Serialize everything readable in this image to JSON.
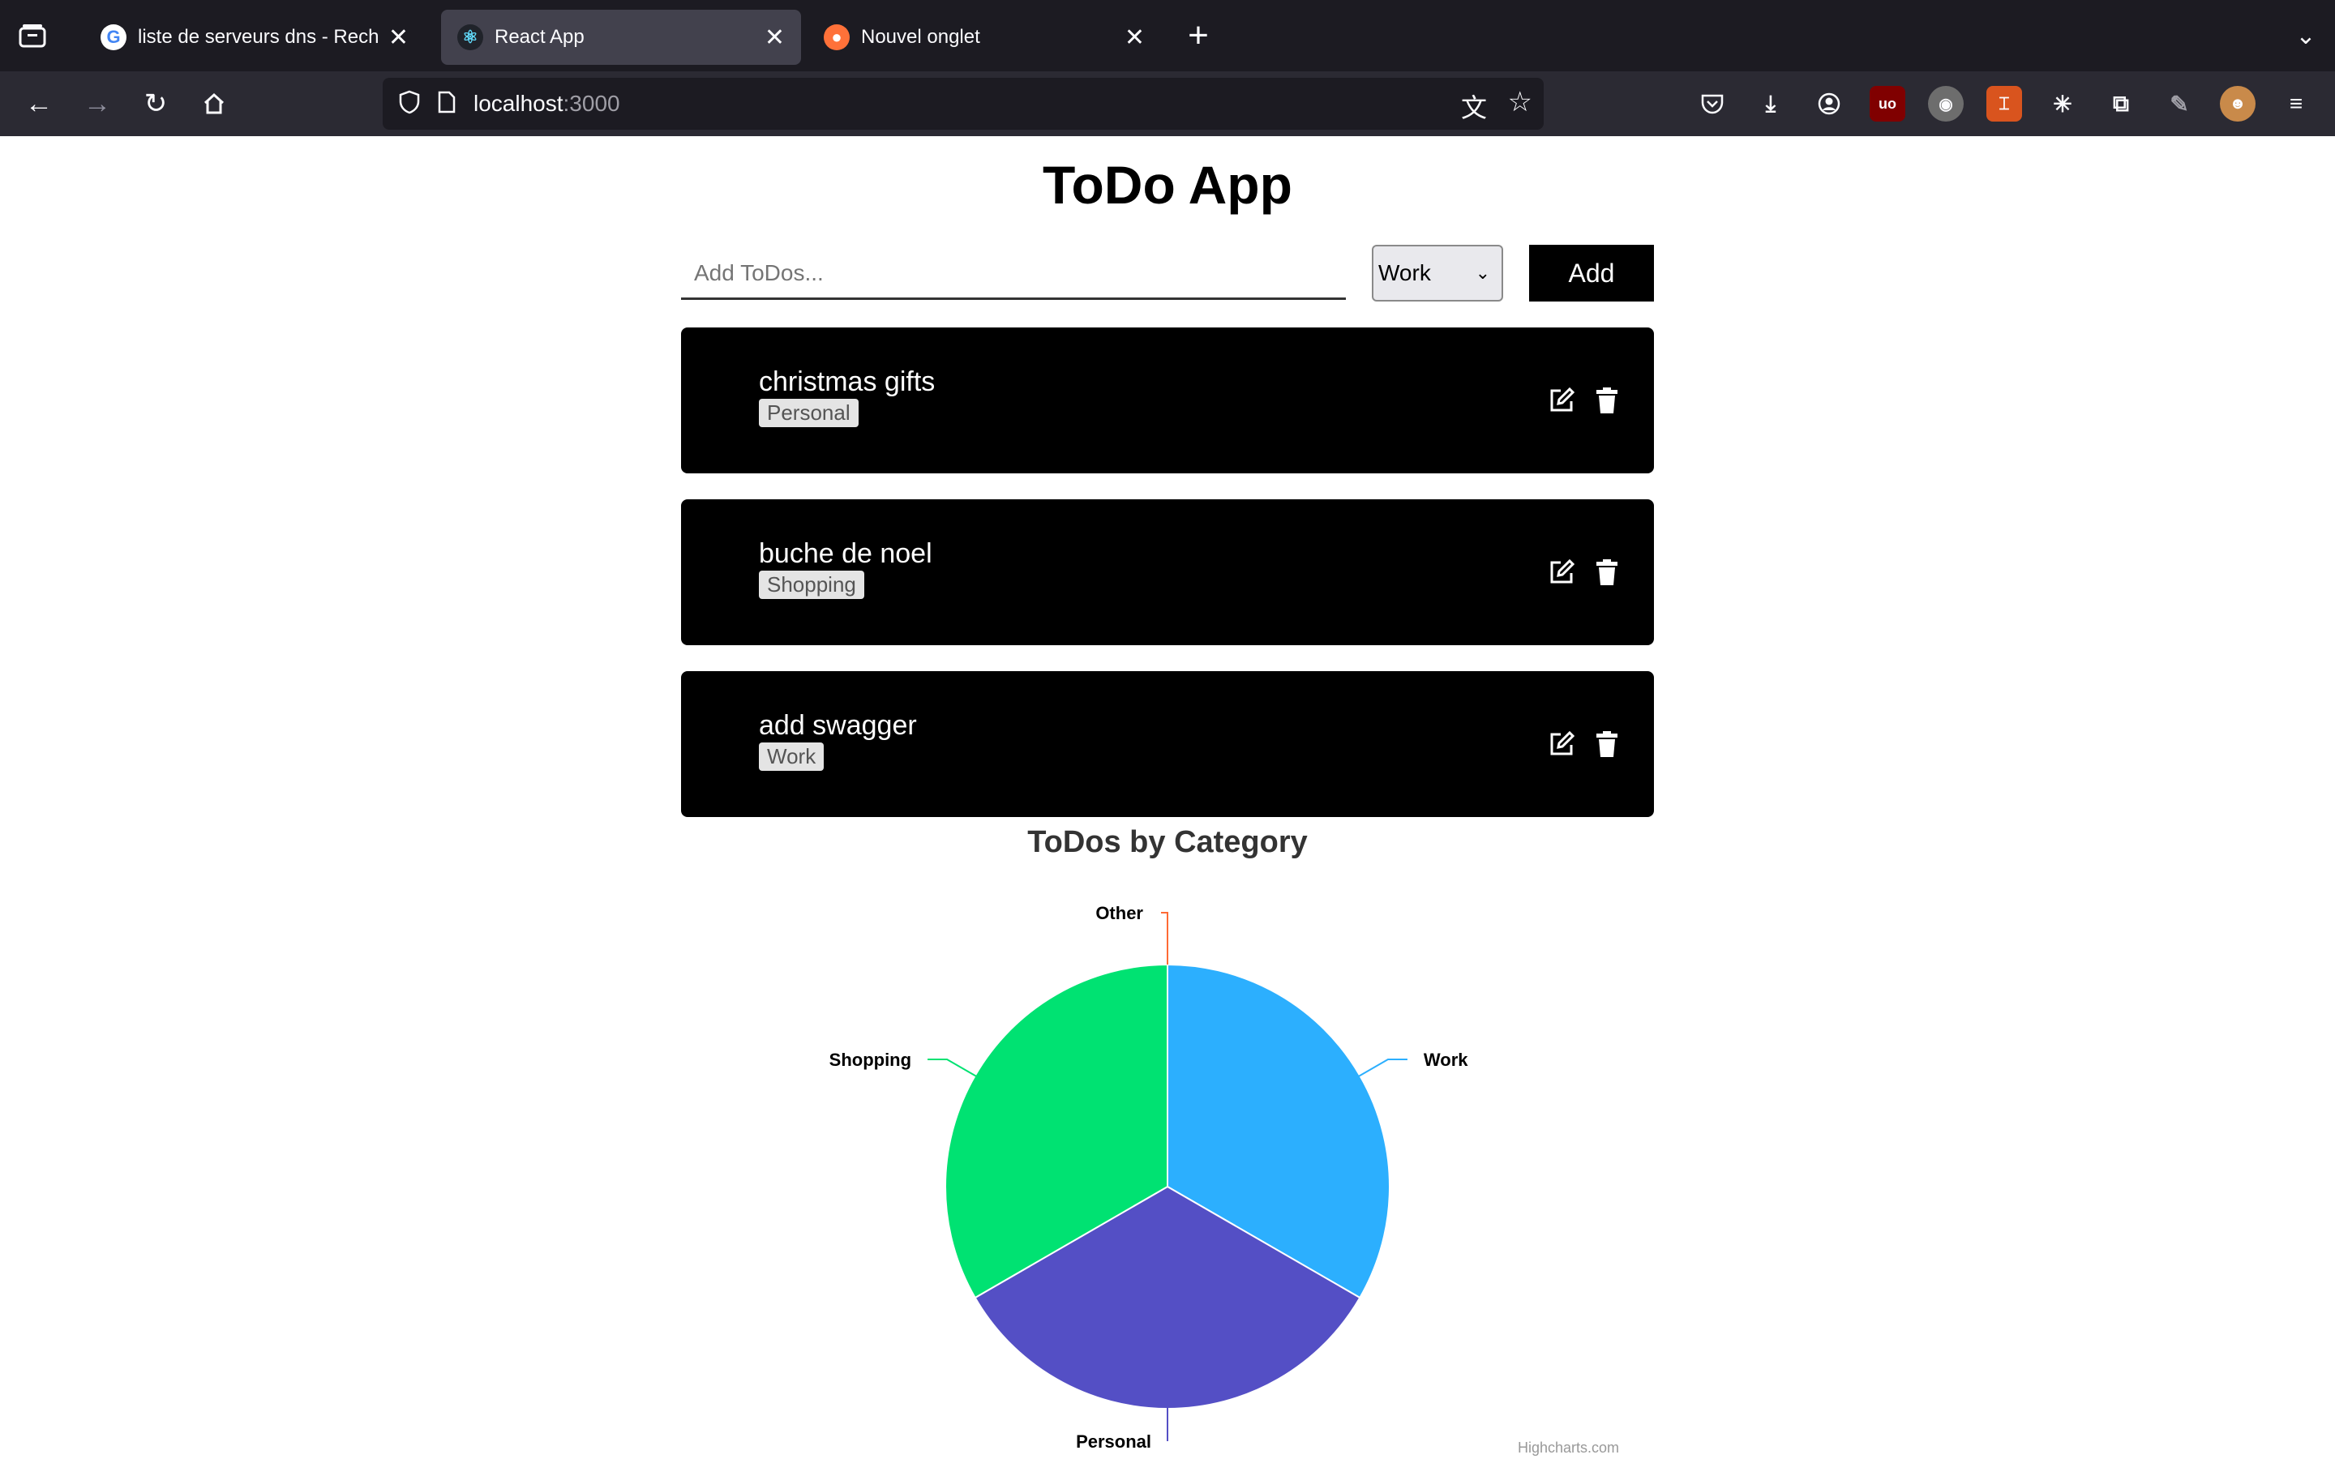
{
  "browser": {
    "tabs": [
      {
        "title": "liste de serveurs dns - Recherch",
        "favicon": "google-icon",
        "active": false
      },
      {
        "title": "React App",
        "favicon": "react-icon",
        "active": true
      },
      {
        "title": "Nouvel onglet",
        "favicon": "firefox-icon",
        "active": false
      }
    ],
    "new_tab_label": "+",
    "url": {
      "host": "localhost",
      "port": ":3000"
    }
  },
  "app": {
    "title": "ToDo App",
    "input": {
      "placeholder": "Add ToDos...",
      "value": ""
    },
    "category_select": {
      "selected": "Work"
    },
    "add_label": "Add",
    "todos": [
      {
        "text": "christmas gifts",
        "category": "Personal"
      },
      {
        "text": "buche de noel",
        "category": "Shopping"
      },
      {
        "text": "add swagger",
        "category": "Work"
      }
    ]
  },
  "chart_title": "ToDos by Category",
  "credits": "Highcharts.com",
  "chart_data": {
    "type": "pie",
    "title": "ToDos by Category",
    "slices": [
      {
        "name": "Work",
        "value": 1,
        "color": "#2caffe"
      },
      {
        "name": "Personal",
        "value": 1,
        "color": "#544fc5"
      },
      {
        "name": "Shopping",
        "value": 1,
        "color": "#00e272"
      },
      {
        "name": "Other",
        "value": 0,
        "color": "#fe6a35"
      }
    ]
  },
  "colors": {
    "tabbar_bg": "#1c1b22",
    "toolbar_bg": "#2b2a33",
    "card_bg": "#000000",
    "tag_bg": "#e4e4e4"
  }
}
